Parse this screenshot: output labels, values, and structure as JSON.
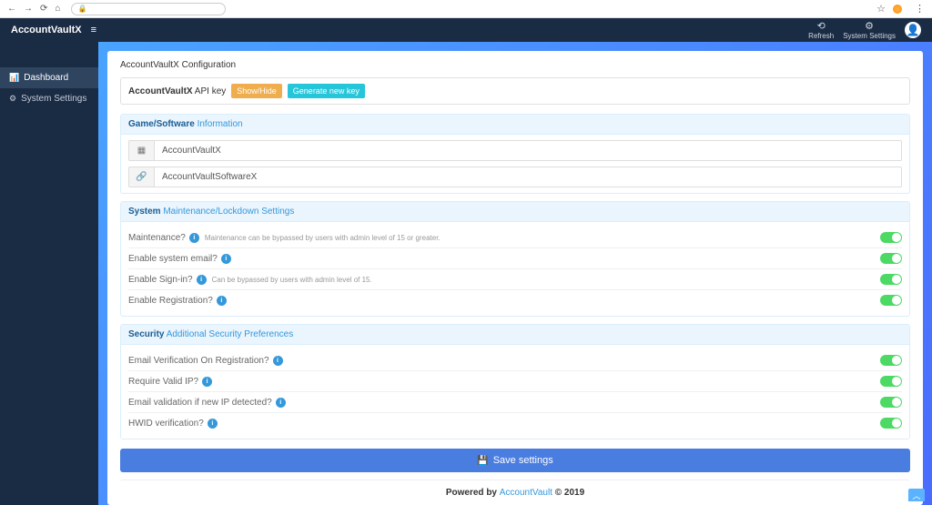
{
  "browser": {
    "star": "☆",
    "dots": "⋮"
  },
  "topbar": {
    "brand": "AccountVaultX",
    "refresh": "Refresh",
    "settings": "System Settings"
  },
  "sidebar": {
    "dashboard": "Dashboard",
    "system_settings": "System Settings"
  },
  "card": {
    "title": "AccountVaultX Configuration",
    "apikey_bold": "AccountVaultX",
    "apikey_rest": " API key",
    "btn_showhide": "Show/Hide",
    "btn_genkey": "Generate new key"
  },
  "panel_game": {
    "head_bold": "Game/Software",
    "head_rest": " Information",
    "input_name": "AccountVaultX",
    "input_software": "AccountVaultSoftwareX"
  },
  "panel_system": {
    "head_bold": "System",
    "head_rest": " Maintenance/Lockdown Settings",
    "rows": [
      {
        "label": "Maintenance?",
        "hint": "Maintenance can be bypassed by users with admin level of 15 or greater."
      },
      {
        "label": "Enable system email?",
        "hint": ""
      },
      {
        "label": "Enable Sign-in?",
        "hint": "Can be bypassed by users with admin level of 15."
      },
      {
        "label": "Enable Registration?",
        "hint": ""
      }
    ]
  },
  "panel_security": {
    "head_bold": "Security",
    "head_rest": " Additional Security Preferences",
    "rows": [
      {
        "label": "Email Verification On Registration?"
      },
      {
        "label": "Require Valid IP?"
      },
      {
        "label": "Email validation if new IP detected?"
      },
      {
        "label": "HWID verification?"
      }
    ]
  },
  "save_btn": "Save settings",
  "footer": {
    "pre": "Powered by ",
    "link": "AccountVault",
    "post": " © 2019"
  }
}
